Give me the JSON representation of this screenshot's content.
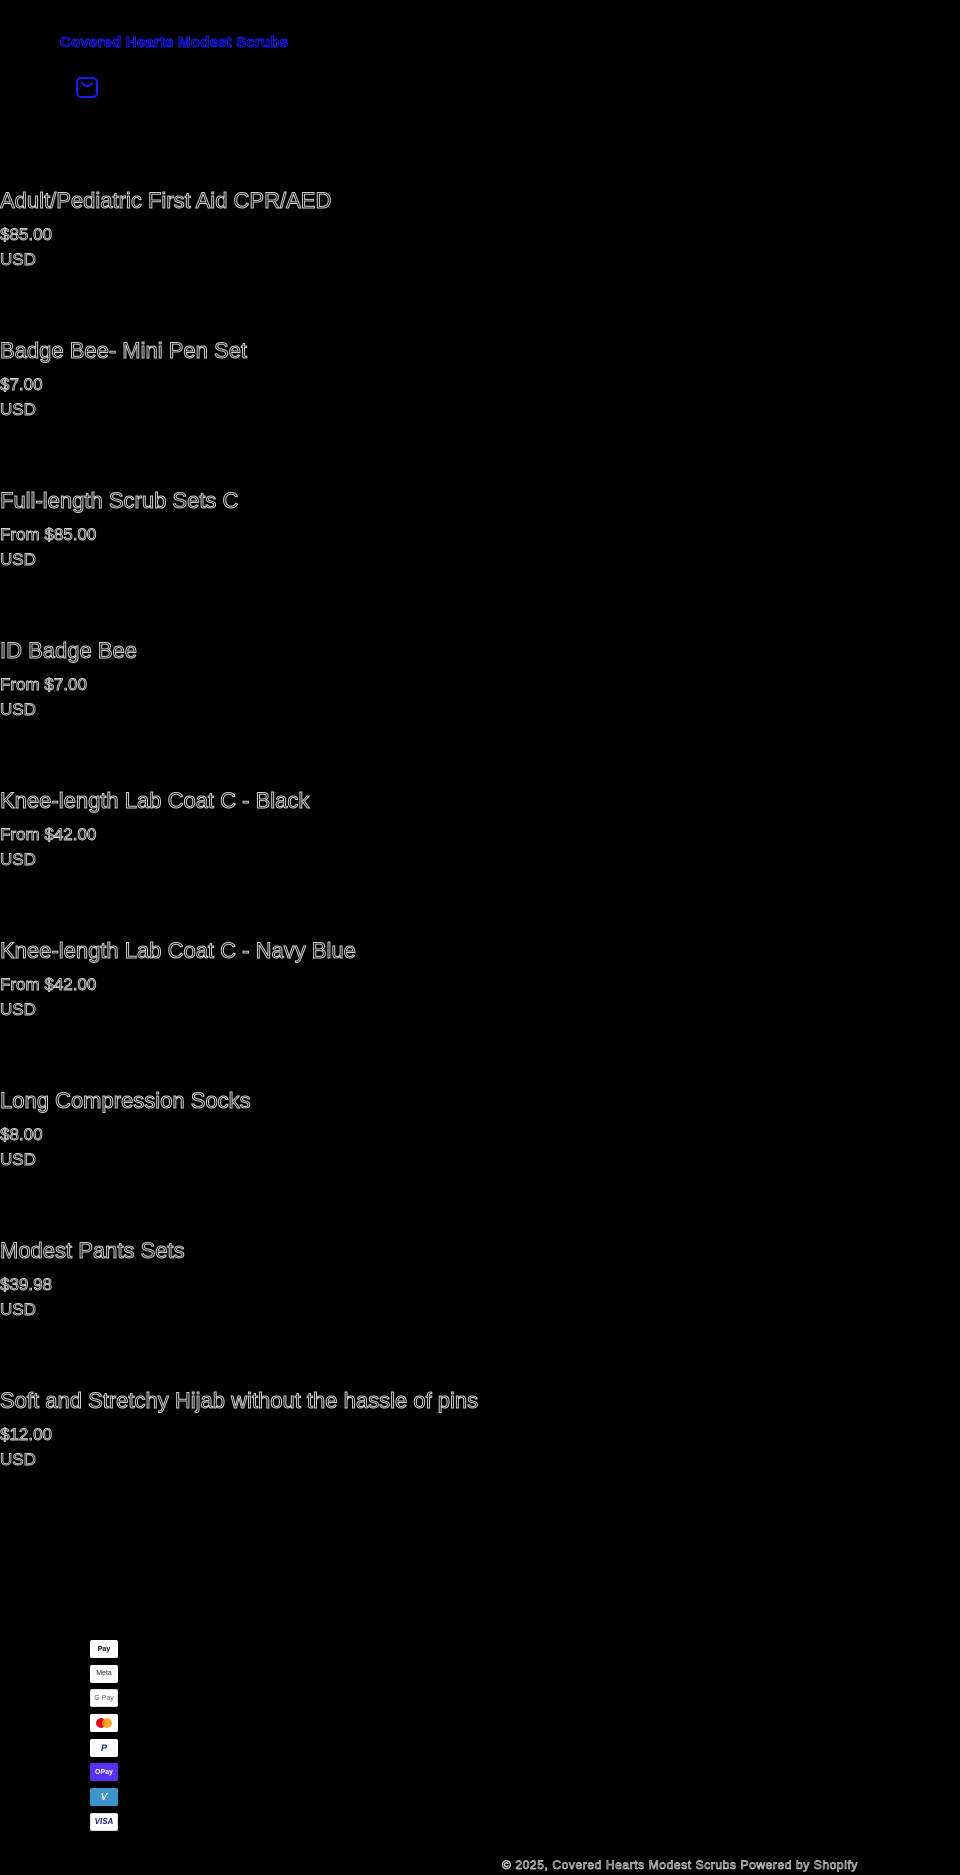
{
  "header": {
    "store_name": "Covered Hearts Modest Scrubs",
    "cart_icon": "shopping-bag-icon"
  },
  "products": [
    {
      "title": "Adult/Pediatric First Aid CPR/AED",
      "price": "$85.00",
      "currency": "USD"
    },
    {
      "title": "Badge Bee- Mini Pen Set",
      "price": "$7.00",
      "currency": "USD"
    },
    {
      "title": "Full-length Scrub Sets C",
      "price": "From $85.00",
      "currency": "USD"
    },
    {
      "title": "ID Badge Bee",
      "price": "From $7.00",
      "currency": "USD"
    },
    {
      "title": "Knee-length Lab Coat C - Black",
      "price": "From $42.00",
      "currency": "USD"
    },
    {
      "title": "Knee-length Lab Coat C - Navy Blue",
      "price": "From $42.00",
      "currency": "USD"
    },
    {
      "title": "Long Compression Socks",
      "price": "$8.00",
      "currency": "USD"
    },
    {
      "title": "Modest Pants Sets",
      "price": "$39.98",
      "currency": "USD"
    },
    {
      "title": "Soft and Stretchy Hijab without the hassle of pins",
      "price": "$12.00",
      "currency": "USD"
    }
  ],
  "payment_methods": [
    {
      "label": "Pay",
      "icon": "apple-pay-icon"
    },
    {
      "label": "Meta",
      "icon": "meta-pay-icon"
    },
    {
      "label": "G Pay",
      "icon": "google-pay-icon"
    },
    {
      "label": "",
      "icon": "mastercard-icon"
    },
    {
      "label": "P",
      "icon": "paypal-icon"
    },
    {
      "label": "OPay",
      "icon": "shop-pay-icon"
    },
    {
      "label": "V",
      "icon": "venmo-icon"
    },
    {
      "label": "VISA",
      "icon": "visa-icon"
    }
  ],
  "footer": {
    "copyright": "© 2025, Covered Hearts Modest Scrubs Powered by Shopify"
  },
  "colors": {
    "background": "#000000",
    "link": "#1a1aff",
    "text_outline": "#cfcfcf"
  }
}
